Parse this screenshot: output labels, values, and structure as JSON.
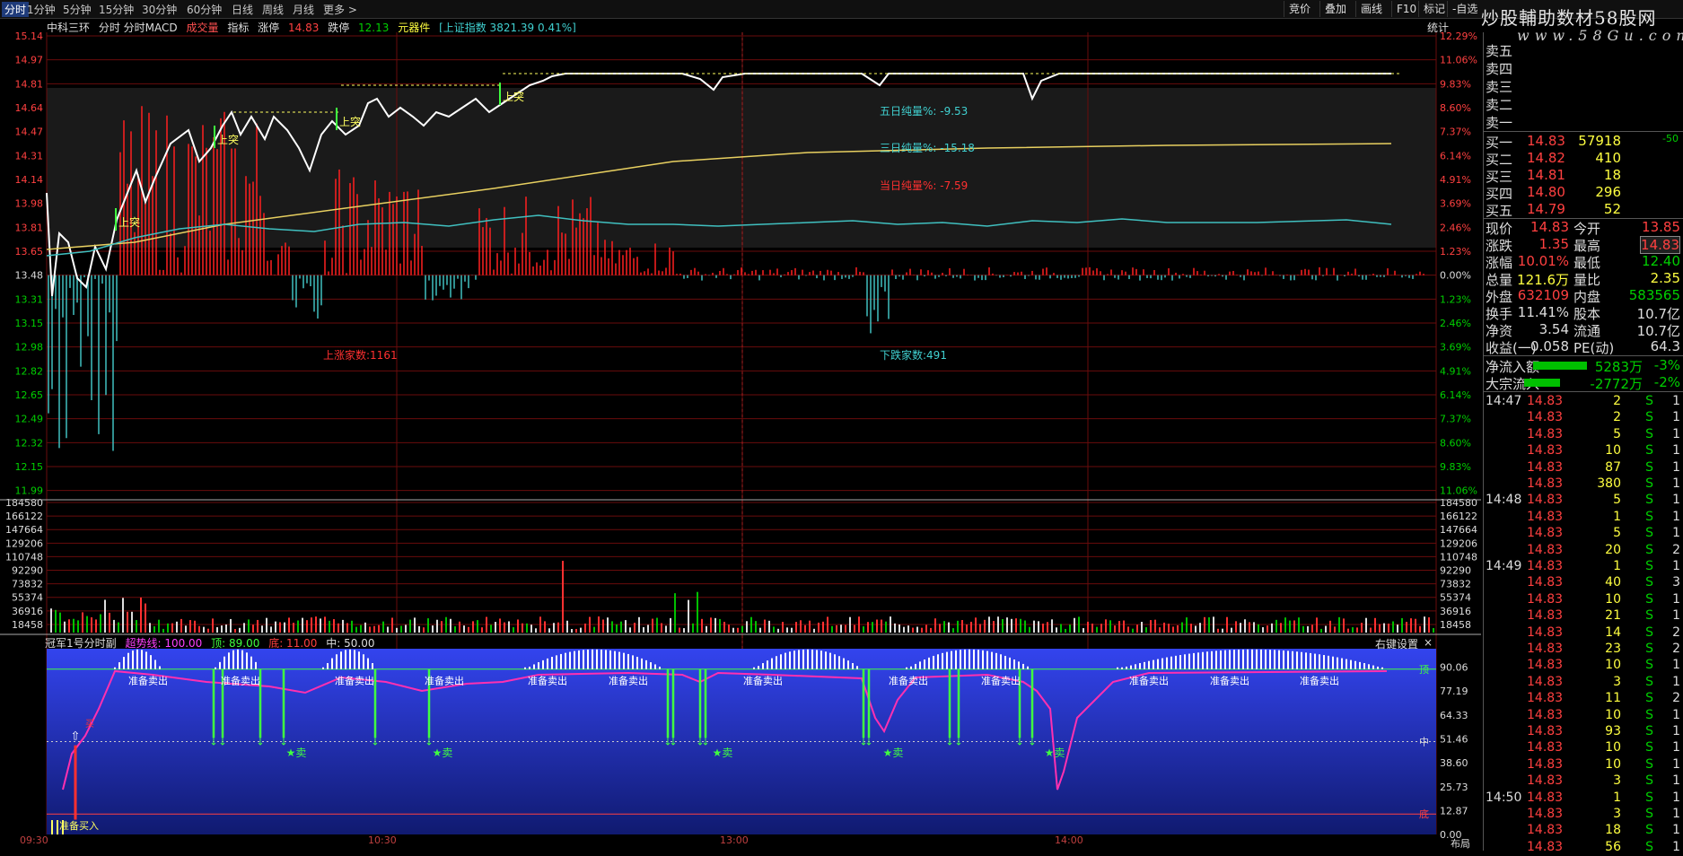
{
  "topbar": {
    "tabs": [
      "分时",
      "1分钟",
      "5分钟",
      "15分钟",
      "30分钟",
      "60分钟",
      "日线",
      "周线",
      "月线",
      "更多 >"
    ],
    "right_buttons": [
      "竞价",
      "叠加",
      "画线",
      "F10",
      "标记",
      "-自选"
    ],
    "watermark": "炒股輔助数材58股网",
    "watermark_url": "www.58Gu.com"
  },
  "info": {
    "name": "中科三环",
    "indicator": "分时 分时MACD",
    "chip1": "成交量",
    "chip2": "指标",
    "limit_up_label": "涨停",
    "limit_up_value": "14.83",
    "limit_down_label": "跌停",
    "limit_down_value": "12.13",
    "sector": "元器件",
    "index_text": "[上证指数 3821.39 0.41%]",
    "stat_button": "统计"
  },
  "price_axis_left": [
    "15.14",
    "14.97",
    "14.81",
    "14.64",
    "14.47",
    "14.31",
    "14.14",
    "13.98",
    "13.81",
    "13.65",
    "13.48",
    "13.31",
    "13.15",
    "12.98",
    "12.82",
    "12.65",
    "12.49",
    "12.32",
    "12.15",
    "11.99"
  ],
  "price_axis_right": [
    "12.29%",
    "11.06%",
    "9.83%",
    "8.60%",
    "7.37%",
    "6.14%",
    "4.91%",
    "3.69%",
    "2.46%",
    "1.23%",
    "0.00%",
    "1.23%",
    "2.46%",
    "3.69%",
    "4.91%",
    "6.14%",
    "7.37%",
    "8.60%",
    "9.83%",
    "11.06%"
  ],
  "volume_axis": [
    "184580",
    "166122",
    "147664",
    "129206",
    "110748",
    "92290",
    "73832",
    "55374",
    "36916",
    "18458"
  ],
  "annotations": {
    "five_day": "五日纯量%: -9.53",
    "three_day": "三日纯量%: -15.18",
    "today": "当日纯量%: -7.59",
    "up_count": "上涨家数:1161",
    "down_count": "下跌家数:491",
    "breakout_label": "上突"
  },
  "indicator_panel": {
    "name": "冠军1号分时副",
    "trend_label": "超势线: 100.00",
    "top_label": "顶: 89.00",
    "bottom_label": "底: 11.00",
    "mid_label": "中: 50.00",
    "settings_button": "右键设置",
    "close": "×",
    "axis": [
      "90.06",
      "77.19",
      "64.33",
      "51.46",
      "38.60",
      "25.73",
      "12.87",
      "0.00"
    ],
    "side_top": "顶",
    "side_mid": "中",
    "side_bottom": "底",
    "prepare_sell": "准备卖出",
    "prepare_buy": "准备买入",
    "sell_mark": "★卖",
    "buy_mark": "买"
  },
  "time_axis": [
    "09:30",
    "10:30",
    "13:00",
    "14:00"
  ],
  "layout_button": "布局",
  "orderbook": {
    "sells": [
      "卖五",
      "卖四",
      "卖三",
      "卖二",
      "卖一"
    ],
    "buys": [
      {
        "label": "买一",
        "price": "14.83",
        "vol": "57918",
        "chg": "-50"
      },
      {
        "label": "买二",
        "price": "14.82",
        "vol": "410",
        "chg": ""
      },
      {
        "label": "买三",
        "price": "14.81",
        "vol": "18",
        "chg": ""
      },
      {
        "label": "买四",
        "price": "14.80",
        "vol": "296",
        "chg": ""
      },
      {
        "label": "买五",
        "price": "14.79",
        "vol": "52",
        "chg": ""
      }
    ]
  },
  "quote": [
    {
      "l1": "现价",
      "v1": "14.83",
      "l2": "今开",
      "v2": "13.85"
    },
    {
      "l1": "涨跌",
      "v1": "1.35",
      "l2": "最高",
      "v2": "14.83"
    },
    {
      "l1": "涨幅",
      "v1": "10.01%",
      "l2": "最低",
      "v2": "12.40"
    },
    {
      "l1": "总量",
      "v1": "121.6万",
      "l2": "量比",
      "v2": "2.35"
    },
    {
      "l1": "外盘",
      "v1": "632109",
      "l2": "内盘",
      "v2": "583565"
    },
    {
      "l1": "换手",
      "v1": "11.41%",
      "l2": "股本",
      "v2": "10.7亿"
    },
    {
      "l1": "净资",
      "v1": "3.54",
      "l2": "流通",
      "v2": "10.7亿"
    },
    {
      "l1": "收益(一)",
      "v1": "0.058",
      "l2": "PE(动)",
      "v2": "64.3"
    }
  ],
  "flows": [
    {
      "label": "净流入额",
      "value": "5283万",
      "pct": "-3%"
    },
    {
      "label": "大宗流入",
      "value": "-2772万",
      "pct": "-2%"
    }
  ],
  "ticks": [
    {
      "time": "14:47",
      "price": "14.83",
      "vol": "2",
      "side": "S",
      "n": "1"
    },
    {
      "time": "",
      "price": "14.83",
      "vol": "2",
      "side": "S",
      "n": "1"
    },
    {
      "time": "",
      "price": "14.83",
      "vol": "5",
      "side": "S",
      "n": "1"
    },
    {
      "time": "",
      "price": "14.83",
      "vol": "10",
      "side": "S",
      "n": "1"
    },
    {
      "time": "",
      "price": "14.83",
      "vol": "87",
      "side": "S",
      "n": "1"
    },
    {
      "time": "",
      "price": "14.83",
      "vol": "380",
      "side": "S",
      "n": "1"
    },
    {
      "time": "14:48",
      "price": "14.83",
      "vol": "5",
      "side": "S",
      "n": "1"
    },
    {
      "time": "",
      "price": "14.83",
      "vol": "1",
      "side": "S",
      "n": "1"
    },
    {
      "time": "",
      "price": "14.83",
      "vol": "5",
      "side": "S",
      "n": "1"
    },
    {
      "time": "",
      "price": "14.83",
      "vol": "20",
      "side": "S",
      "n": "2"
    },
    {
      "time": "14:49",
      "price": "14.83",
      "vol": "1",
      "side": "S",
      "n": "1"
    },
    {
      "time": "",
      "price": "14.83",
      "vol": "40",
      "side": "S",
      "n": "3"
    },
    {
      "time": "",
      "price": "14.83",
      "vol": "10",
      "side": "S",
      "n": "1"
    },
    {
      "time": "",
      "price": "14.83",
      "vol": "21",
      "side": "S",
      "n": "1"
    },
    {
      "time": "",
      "price": "14.83",
      "vol": "14",
      "side": "S",
      "n": "2"
    },
    {
      "time": "",
      "price": "14.83",
      "vol": "23",
      "side": "S",
      "n": "2"
    },
    {
      "time": "",
      "price": "14.83",
      "vol": "10",
      "side": "S",
      "n": "1"
    },
    {
      "time": "",
      "price": "14.83",
      "vol": "3",
      "side": "S",
      "n": "1"
    },
    {
      "time": "",
      "price": "14.83",
      "vol": "11",
      "side": "S",
      "n": "2"
    },
    {
      "time": "",
      "price": "14.83",
      "vol": "10",
      "side": "S",
      "n": "1"
    },
    {
      "time": "",
      "price": "14.83",
      "vol": "93",
      "side": "S",
      "n": "1"
    },
    {
      "time": "",
      "price": "14.83",
      "vol": "10",
      "side": "S",
      "n": "1"
    },
    {
      "time": "",
      "price": "14.83",
      "vol": "10",
      "side": "S",
      "n": "1"
    },
    {
      "time": "",
      "price": "14.83",
      "vol": "3",
      "side": "S",
      "n": "1"
    },
    {
      "time": "14:50",
      "price": "14.83",
      "vol": "1",
      "side": "S",
      "n": "1"
    },
    {
      "time": "",
      "price": "14.83",
      "vol": "3",
      "side": "S",
      "n": "1"
    },
    {
      "time": "",
      "price": "14.83",
      "vol": "18",
      "side": "S",
      "n": "1"
    },
    {
      "time": "",
      "price": "14.83",
      "vol": "56",
      "side": "S",
      "n": "1"
    }
  ],
  "colors": {
    "up": "#ff3030",
    "down": "#00c000",
    "yellow": "#ffff00",
    "cyan": "#40c0c0",
    "grid": "#7a1010"
  }
}
